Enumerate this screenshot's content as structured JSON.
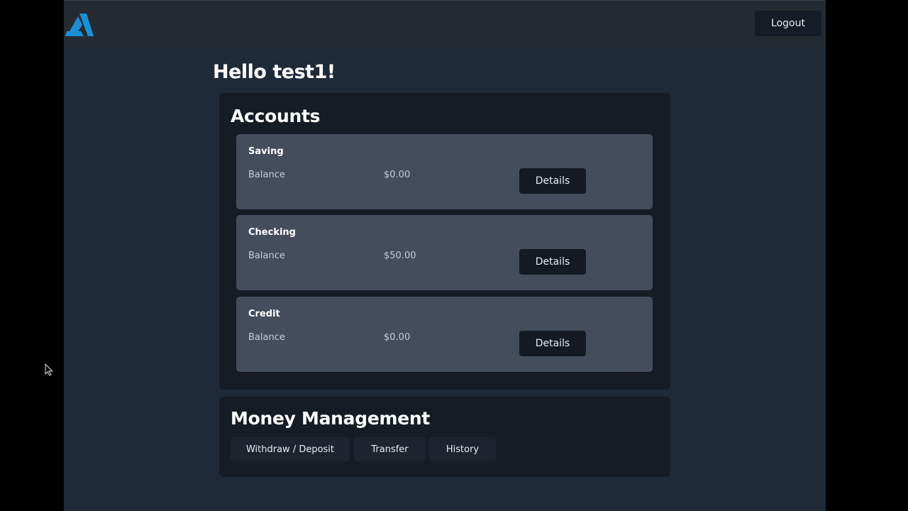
{
  "header": {
    "logo_icon": "triangle-logo-icon",
    "logout_label": "Logout",
    "brand_color": "#1a8fd6"
  },
  "greeting": "Hello test1!",
  "accounts": {
    "title": "Accounts",
    "items": [
      {
        "name": "Saving",
        "balance_label": "Balance",
        "balance": "$0.00",
        "details_label": "Details"
      },
      {
        "name": "Checking",
        "balance_label": "Balance",
        "balance": "$50.00",
        "details_label": "Details"
      },
      {
        "name": "Credit",
        "balance_label": "Balance",
        "balance": "$0.00",
        "details_label": "Details"
      }
    ]
  },
  "money_management": {
    "title": "Money Management",
    "buttons": {
      "withdraw_deposit": "Withdraw / Deposit",
      "transfer": "Transfer",
      "history": "History"
    }
  },
  "pointer_icon": "mouse-cursor-icon"
}
